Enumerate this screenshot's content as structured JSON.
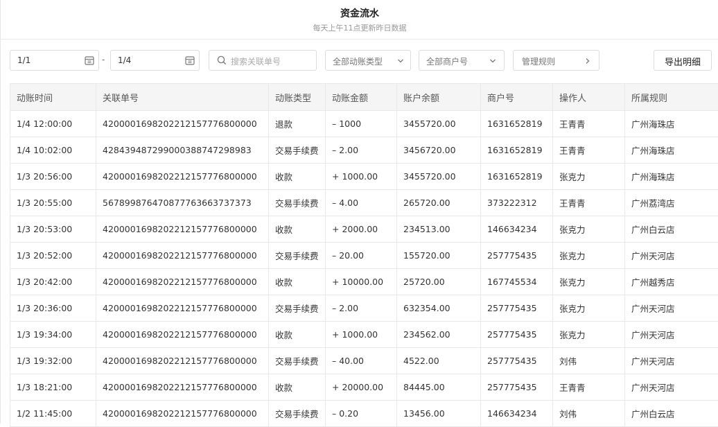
{
  "header": {
    "title": "资金流水",
    "subtitle": "每天上午11点更新昨日数据"
  },
  "filters": {
    "date_start": "1/1",
    "date_separator": "-",
    "date_end": "1/4",
    "search_placeholder": "搜索关联单号",
    "type_select": "全部动账类型",
    "merchant_select": "全部商户号",
    "rules_label": "管理规则",
    "export_label": "导出明细"
  },
  "icons": {
    "calendar": "calendar-icon",
    "search": "search-icon",
    "chevron_down": "chevron-down-icon",
    "chevron_right": "chevron-right-icon"
  },
  "colors": {
    "negative": "#f5a04a",
    "positive": "#3cc26a"
  },
  "table": {
    "columns": [
      "动账时间",
      "关联单号",
      "动账类型",
      "动账金额",
      "账户余额",
      "商户号",
      "操作人",
      "所属规则"
    ],
    "rows": [
      [
        "1/4 12:00:00",
        "420000169820221215777680000O",
        "退款",
        "– 1000",
        "3455720.00",
        "1631652819",
        "王青青",
        "广州海珠店"
      ],
      [
        "1/4 10:02:00",
        "42843948729900038874729898З",
        "交易手续费",
        "– 2.00",
        "3456720.00",
        "1631652819",
        "王青青",
        "广州海珠店"
      ],
      [
        "1/3 20:56:00",
        "420000169820221215777680000O",
        "收款",
        "+ 1000.00",
        "3455720.00",
        "1631652819",
        "张克力",
        "广州海珠店"
      ],
      [
        "1/3 20:55:00",
        "5678998764708777636637373 73",
        "交易手续费",
        "– 4.00",
        "265720.00",
        "373222312",
        "王青青",
        "广州荔湾店"
      ],
      [
        "1/3 20:53:00",
        "420000169820221215777680000O",
        "收款",
        "+ 2000.00",
        "234513.00",
        "146634234",
        "张克力",
        "广州白云店"
      ],
      [
        "1/3 20:52:00",
        "420000169820221215777680000O",
        "交易手续费",
        "– 20.00",
        "155720.00",
        "257775435",
        "张克力",
        "广州天河店"
      ],
      [
        "1/3 20:42:00",
        "420000169820221215777680000O",
        "收款",
        "+ 10000.00",
        "25720.00",
        "167745534",
        "张克力",
        "广州越秀店"
      ],
      [
        "1/3 20:36:00",
        "420000169820221215777680000O",
        "交易手续费",
        "– 2.00",
        "632354.00",
        "257775435",
        "张克力",
        "广州天河店"
      ],
      [
        "1/3 19:34:00",
        "420000169820221215777680000O",
        "收款",
        "+ 1000.00",
        "234562.00",
        "257775435",
        "张克力",
        "广州天河店"
      ],
      [
        "1/3 19:32:00",
        "420000169820221215777680000O",
        "交易手续费",
        "– 40.00",
        "4522.00",
        "257775435",
        "刘伟",
        "广州天河店"
      ],
      [
        "1/3 18:21:00",
        "420000169820221215777680000O",
        "收款",
        "+ 20000.00",
        "84445.00",
        "257775435",
        "王青青",
        "广州天河店"
      ],
      [
        "1/2 11:45:00",
        "420000169820221215777680000O",
        "交易手续费",
        "– 0.20",
        "13456.00",
        "146634234",
        "刘伟",
        "广州白云店"
      ]
    ]
  }
}
